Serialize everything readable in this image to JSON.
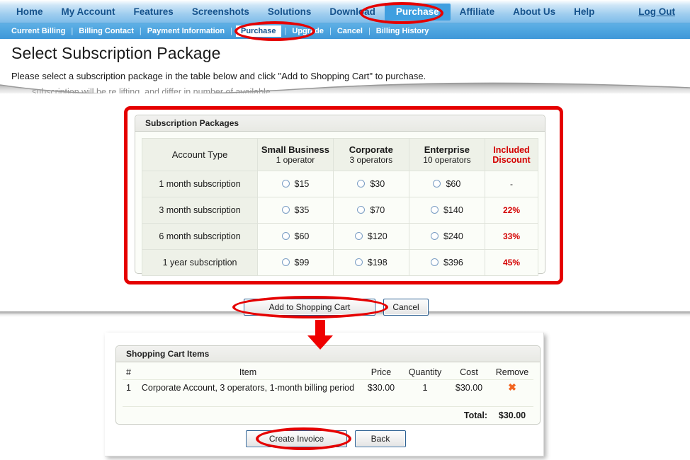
{
  "topnav": {
    "items": [
      {
        "label": "Home",
        "active": false
      },
      {
        "label": "My Account",
        "active": false
      },
      {
        "label": "Features",
        "active": false
      },
      {
        "label": "Screenshots",
        "active": false
      },
      {
        "label": "Solutions",
        "active": false
      },
      {
        "label": "Download",
        "active": false
      },
      {
        "label": "Purchase",
        "active": true
      },
      {
        "label": "Affiliate",
        "active": false
      },
      {
        "label": "About Us",
        "active": false
      },
      {
        "label": "Help",
        "active": false
      }
    ],
    "logout_label": "Log Out"
  },
  "subnav": {
    "items": [
      {
        "label": "Current Billing",
        "active": false
      },
      {
        "label": "Billing Contact",
        "active": false
      },
      {
        "label": "Payment Information",
        "active": false
      },
      {
        "label": "Purchase",
        "active": true
      },
      {
        "label": "Upgrade",
        "active": false
      },
      {
        "label": "Cancel",
        "active": false
      },
      {
        "label": "Billing History",
        "active": false
      }
    ],
    "separator": "|"
  },
  "header": {
    "title": "Select Subscription Package",
    "description": "Please select a subscription package in the table below and click \"Add to Shopping Cart\" to purchase.",
    "description_clipped": "subscription will be re            lifting, and differ in number of available"
  },
  "packages": {
    "legend": "Subscription Packages",
    "columns": [
      {
        "name": "Account Type",
        "sub": "",
        "accent": "#1a1a1a"
      },
      {
        "name": "Small Business",
        "sub": "1 operator",
        "accent": "#1a1a1a"
      },
      {
        "name": "Corporate",
        "sub": "3 operators",
        "accent": "#1a1a1a"
      },
      {
        "name": "Enterprise",
        "sub": "10 operators",
        "accent": "#1a1a1a"
      },
      {
        "name": "Included Discount",
        "sub": "",
        "accent": "#d40000"
      }
    ],
    "column_headers": {
      "account_type": "Account Type",
      "small_business": "Small Business",
      "small_business_sub": "1 operator",
      "corporate": "Corporate",
      "corporate_sub": "3 operators",
      "enterprise": "Enterprise",
      "enterprise_sub": "10 operators",
      "discount_line1": "Included",
      "discount_line2": "Discount"
    },
    "rows": [
      {
        "label": "1 month subscription",
        "small": "$15",
        "corporate": "$30",
        "enterprise": "$60",
        "discount": "-",
        "has_discount": false
      },
      {
        "label": "3 month subscription",
        "small": "$35",
        "corporate": "$70",
        "enterprise": "$140",
        "discount": "22%",
        "has_discount": true
      },
      {
        "label": "6 month subscription",
        "small": "$60",
        "corporate": "$120",
        "enterprise": "$240",
        "discount": "33%",
        "has_discount": true
      },
      {
        "label": "1 year subscription",
        "small": "$99",
        "corporate": "$198",
        "enterprise": "$396",
        "discount": "45%",
        "has_discount": true
      }
    ]
  },
  "actions": {
    "add_to_cart": "Add to Shopping Cart",
    "cancel": "Cancel",
    "create_invoice": "Create Invoice",
    "back": "Back"
  },
  "cart": {
    "legend": "Shopping Cart Items",
    "headers": {
      "num": "#",
      "item": "Item",
      "price": "Price",
      "quantity": "Quantity",
      "cost": "Cost",
      "remove": "Remove"
    },
    "rows": [
      {
        "num": "1",
        "item": "Corporate Account, 3 operators, 1-month billing period",
        "price": "$30.00",
        "quantity": "1",
        "cost": "$30.00",
        "remove_icon": "x-mark-icon"
      }
    ],
    "total_label": "Total:",
    "total_value": "$30.00"
  },
  "annotations": {
    "highlight_color": "#e50000",
    "arrow": "down-arrow",
    "marks": [
      "ellipse-top-purchase",
      "ellipse-subnav-purchase",
      "rounded-rect-packages-table",
      "ellipse-add-to-cart",
      "ellipse-create-invoice"
    ]
  },
  "theme": {
    "nav_accent": "#3f9fe0",
    "subnav_bg": "#4da4df",
    "discount_color": "#d40000",
    "panel_bg": "#fbfdf8",
    "header_cell_bg": "#eef1e8"
  }
}
